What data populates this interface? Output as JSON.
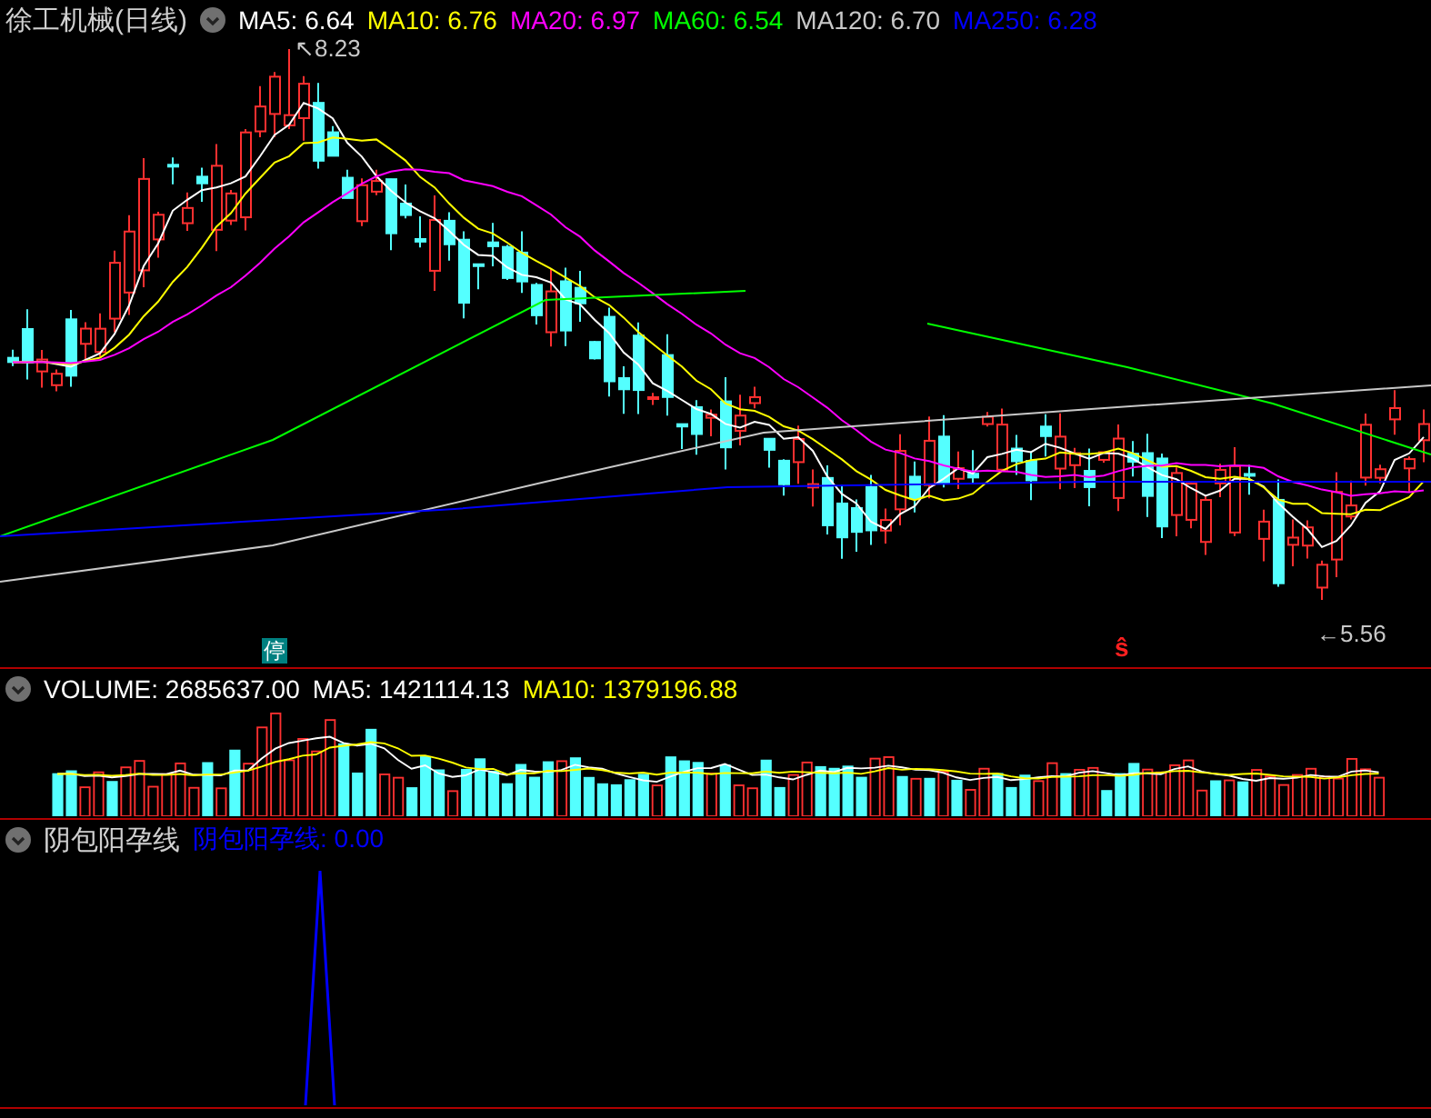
{
  "title": "徐工机械(日线)",
  "main_indicators": [
    {
      "label": "MA5: 6.64",
      "color": "#ffffff"
    },
    {
      "label": "MA10: 6.76",
      "color": "#ffff00"
    },
    {
      "label": "MA20: 6.97",
      "color": "#ff00ff"
    },
    {
      "label": "MA60: 6.54",
      "color": "#00ff00"
    },
    {
      "label": "MA120: 6.70",
      "color": "#c8c8c8"
    },
    {
      "label": "MA250: 6.28",
      "color": "#0000ff"
    }
  ],
  "price_labels": [
    {
      "text": "↖8.23",
      "kind": "high"
    },
    {
      "text": "←5.56",
      "kind": "low"
    }
  ],
  "markers": [
    {
      "text": "停",
      "kind": "badge"
    },
    {
      "text": "ŝ",
      "kind": "signal"
    }
  ],
  "volume_panel": {
    "indicators": [
      {
        "label": "VOLUME: 2685637.00",
        "color": "#ffffff"
      },
      {
        "label": "MA5: 1421114.13",
        "color": "#ffffff"
      },
      {
        "label": "MA10: 1379196.88",
        "color": "#ffff00"
      }
    ]
  },
  "pattern_panel": {
    "title": "阴包阳孕线",
    "indicators": [
      {
        "label": "阴包阳孕线: 0.00",
        "color": "#0000ff"
      }
    ]
  }
}
